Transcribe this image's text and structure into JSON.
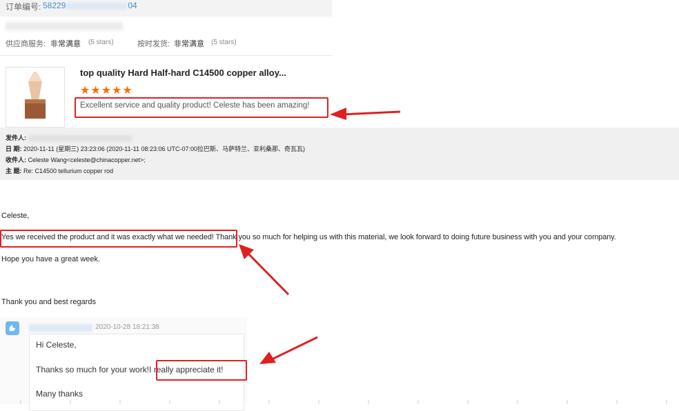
{
  "order": {
    "number_label": "订单编号:",
    "number_value_start": "58229",
    "number_value_end": "04"
  },
  "ratings": {
    "supplier_service_label": "供应商服务:",
    "supplier_service_value": "非常满意",
    "supplier_service_stars": "(5 stars)",
    "ontime_label": "按时发货:",
    "ontime_value": "非常满意",
    "ontime_stars": "(5 stars)"
  },
  "product": {
    "title": "top quality Hard Half-hard C14500 copper alloy...",
    "rating": 5,
    "stars_glyph": "★★★★★",
    "review": "Excellent service and quality product! Celeste has been amazing!"
  },
  "mail": {
    "from_label": "发件人:",
    "date_label": "日  期:",
    "date_value": "2020-11-11 (星期三) 23:23:06 (2020-11-11 08:23:06 UTC-07:00拉巴斯、马萨特兰、亚利桑那、奇瓦瓦)",
    "to_label": "收件人:",
    "to_value": "Celeste Wang<celeste@chinacopper.net>;",
    "subject_label": "主  题:",
    "subject_value": "Re: C14500 tellurium copper rod",
    "greeting": "Celeste,",
    "line1_highlight": "Yes we received the product and it was exactly what we needed!",
    "line1_rest": " Thank you so much for helping us with this material, we look forward to doing future business with you and your company.",
    "line2": "Hope you have a great week.",
    "closing": "Thank you and best regards"
  },
  "chat": {
    "timestamp": "2020-10-28 18:21:38",
    "greeting": "Hi Celeste,",
    "line_start": "Thanks so much for your work!",
    "line_highlight": "I really appreciate it!",
    "sign_off": "Many thanks"
  },
  "colors": {
    "accent_link": "#3a8fd6",
    "star": "#ff6a00",
    "annotation_red": "#e02020"
  }
}
